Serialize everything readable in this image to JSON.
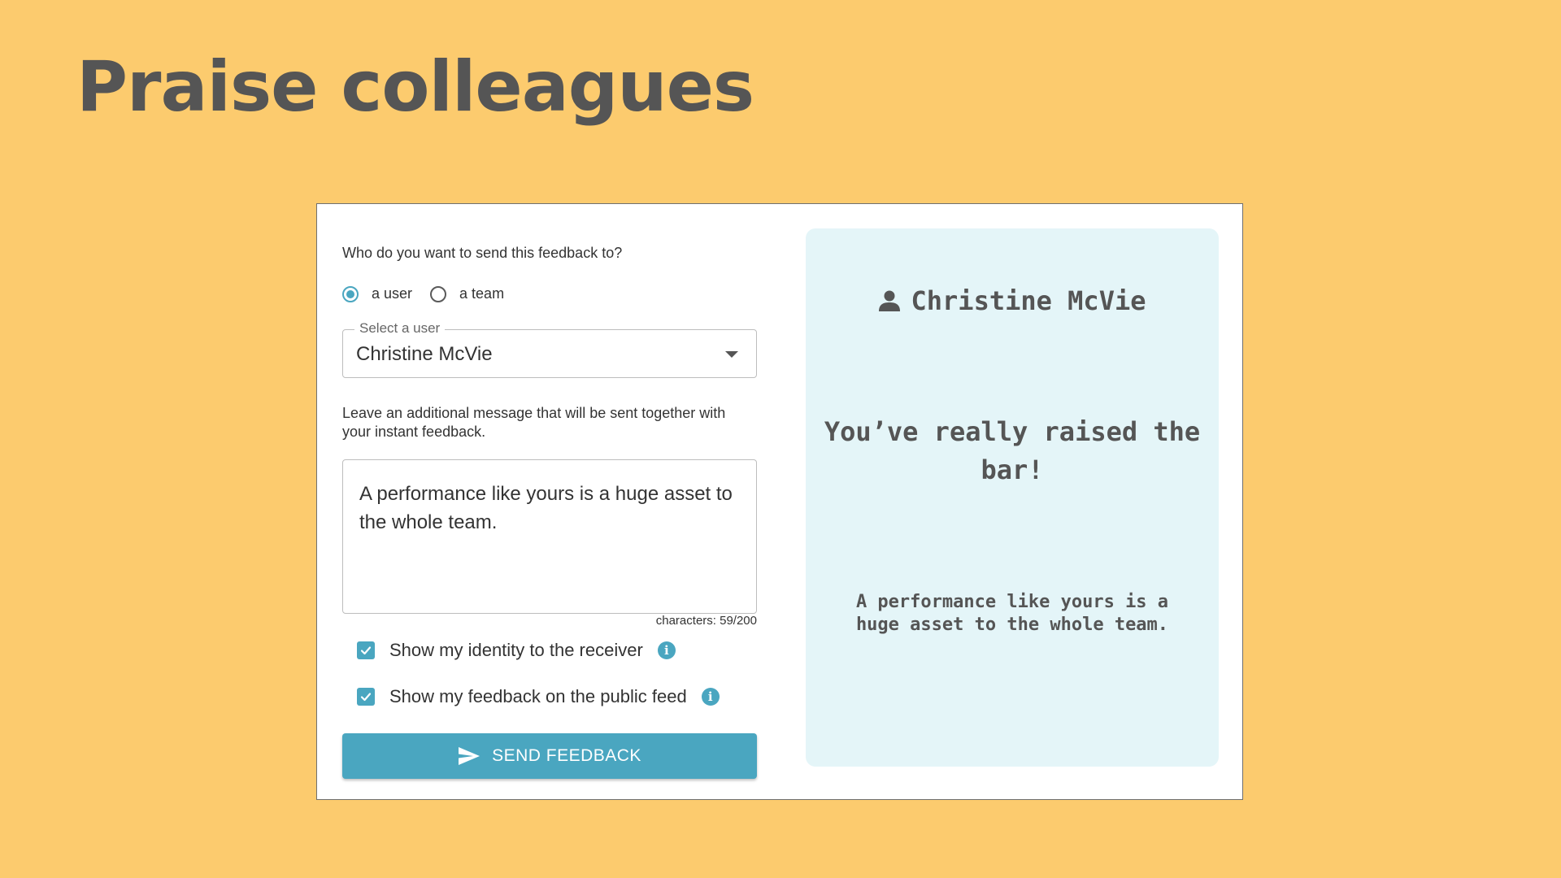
{
  "page": {
    "title": "Praise colleagues"
  },
  "form": {
    "question": "Who do you want to send this feedback to?",
    "recipient_options": [
      {
        "label": "a user",
        "selected": true
      },
      {
        "label": "a team",
        "selected": false
      }
    ],
    "select": {
      "label": "Select a user",
      "value": "Christine McVie"
    },
    "message_label": "Leave an additional message that will be sent together with your instant feedback.",
    "message_value": "A performance like yours is a huge asset to the whole team.",
    "char_count": "characters: 59/200",
    "checkboxes": [
      {
        "label": "Show my identity to the receiver",
        "checked": true
      },
      {
        "label": "Show my feedback on the public feed",
        "checked": true
      }
    ],
    "send_label": "SEND FEEDBACK"
  },
  "preview": {
    "name": "Christine McVie",
    "headline": "You’ve really raised the bar!",
    "message": "A performance like yours is a huge asset to the whole team."
  },
  "colors": {
    "background": "#FCCB6E",
    "accent": "#4AA6C0",
    "preview_bg": "#E4F5F8",
    "title_text": "#555555"
  },
  "icons": {
    "person": "person-icon",
    "send": "send-icon",
    "info": "info-icon",
    "checkbox": "check-icon",
    "dropdown": "chevron-down-icon"
  }
}
